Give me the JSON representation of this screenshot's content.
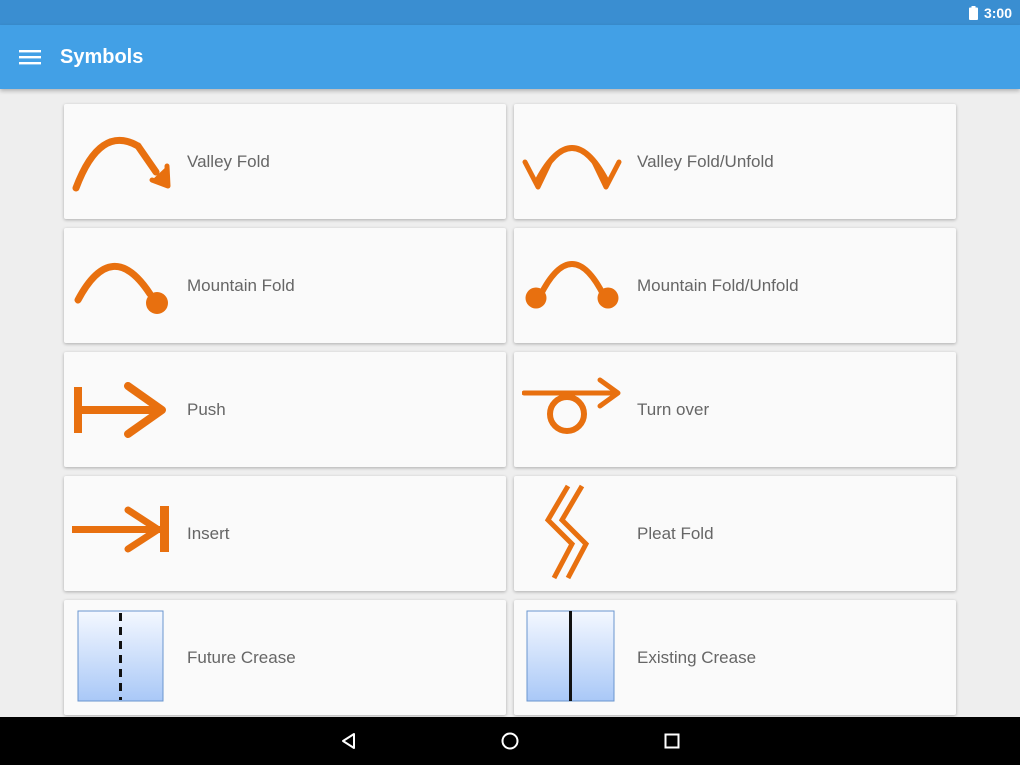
{
  "status": {
    "time": "3:00",
    "battery_icon": "battery-full-icon"
  },
  "appbar": {
    "title": "Symbols",
    "menu_icon": "hamburger-menu-icon"
  },
  "colors": {
    "status_bar": "#3a8ed1",
    "app_bar": "#42a0e6",
    "symbol_orange": "#e8700f",
    "card_bg": "#fafafa",
    "label_text": "#666666",
    "crease_fill": "#c9dcfb"
  },
  "symbols": [
    {
      "label": "Valley Fold",
      "icon": "valley-fold-icon"
    },
    {
      "label": "Valley Fold/Unfold",
      "icon": "valley-fold-unfold-icon"
    },
    {
      "label": "Mountain Fold",
      "icon": "mountain-fold-icon"
    },
    {
      "label": "Mountain Fold/Unfold",
      "icon": "mountain-fold-unfold-icon"
    },
    {
      "label": "Push",
      "icon": "push-icon"
    },
    {
      "label": "Turn over",
      "icon": "turn-over-icon"
    },
    {
      "label": "Insert",
      "icon": "insert-icon"
    },
    {
      "label": "Pleat Fold",
      "icon": "pleat-fold-icon"
    },
    {
      "label": "Future Crease",
      "icon": "future-crease-icon"
    },
    {
      "label": "Existing Crease",
      "icon": "existing-crease-icon"
    }
  ],
  "navbar": {
    "back_icon": "back-triangle-icon",
    "home_icon": "home-circle-icon",
    "recents_icon": "recents-square-icon"
  }
}
